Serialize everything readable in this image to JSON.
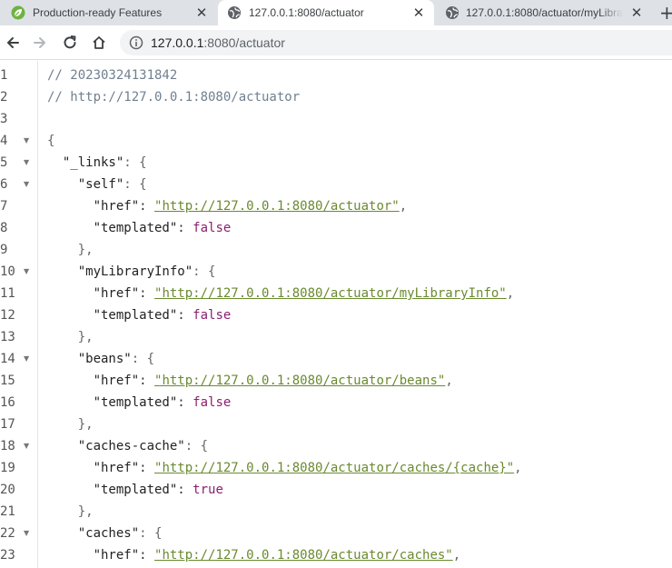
{
  "tabs": [
    {
      "title": "Production-ready Features",
      "favicon": "spring-leaf-icon",
      "close": "✕"
    },
    {
      "title": "127.0.0.1:8080/actuator",
      "favicon": "globe-icon",
      "close": "✕"
    },
    {
      "title": "127.0.0.1:8080/actuator/myLibra",
      "favicon": "globe-icon",
      "close": "✕"
    }
  ],
  "new_tab": "+",
  "omnibox": {
    "host": "127.0.0.1",
    "path": ":8080/actuator"
  },
  "json_view": {
    "lines": [
      {
        "n": "1",
        "text": "// 20230324131842"
      },
      {
        "n": "2",
        "text": "// http://127.0.0.1:8080/actuator"
      },
      {
        "n": "3",
        "text": ""
      },
      {
        "n": "4",
        "text": "{"
      },
      {
        "n": "5",
        "key": "\"_links\"",
        "rest": ": {"
      },
      {
        "n": "6",
        "key": "\"self\"",
        "rest": ": {"
      },
      {
        "n": "7",
        "key": "\"href\"",
        "link": "\"http://127.0.0.1:8080/actuator\"",
        "after": ","
      },
      {
        "n": "8",
        "key": "\"templated\"",
        "kw": "false"
      },
      {
        "n": "9",
        "text": "},"
      },
      {
        "n": "10",
        "key": "\"myLibraryInfo\"",
        "rest": ": {"
      },
      {
        "n": "11",
        "key": "\"href\"",
        "link": "\"http://127.0.0.1:8080/actuator/myLibraryInfo\"",
        "after": ","
      },
      {
        "n": "12",
        "key": "\"templated\"",
        "kw": "false"
      },
      {
        "n": "13",
        "text": "},"
      },
      {
        "n": "14",
        "key": "\"beans\"",
        "rest": ": {"
      },
      {
        "n": "15",
        "key": "\"href\"",
        "link": "\"http://127.0.0.1:8080/actuator/beans\"",
        "after": ","
      },
      {
        "n": "16",
        "key": "\"templated\"",
        "kw": "false"
      },
      {
        "n": "17",
        "text": "},"
      },
      {
        "n": "18",
        "key": "\"caches-cache\"",
        "rest": ": {"
      },
      {
        "n": "19",
        "key": "\"href\"",
        "link": "\"http://127.0.0.1:8080/actuator/caches/{cache}\"",
        "after": ","
      },
      {
        "n": "20",
        "key": "\"templated\"",
        "kw": "true"
      },
      {
        "n": "21",
        "text": "},"
      },
      {
        "n": "22",
        "key": "\"caches\"",
        "rest": ": {"
      },
      {
        "n": "23",
        "key": "\"href\"",
        "link": "\"http://127.0.0.1:8080/actuator/caches\"",
        "after": ","
      }
    ]
  },
  "colors": {
    "comment": "#708090",
    "link": "#6a8a2f",
    "keyword": "#8b1f6e"
  }
}
